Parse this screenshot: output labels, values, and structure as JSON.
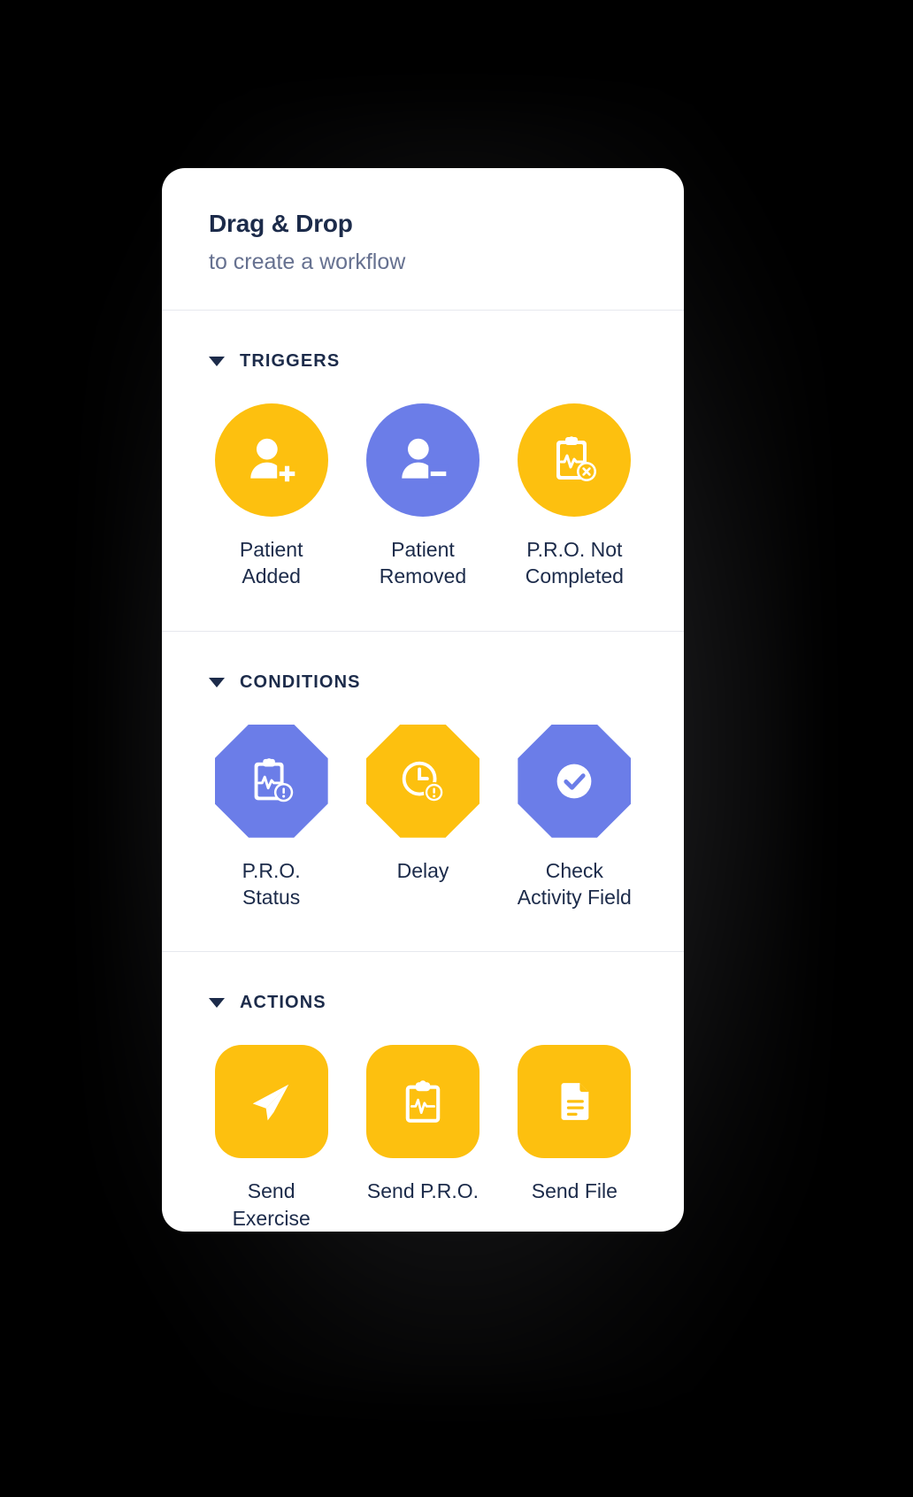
{
  "header": {
    "title": "Drag & Drop",
    "subtitle": "to create a workflow"
  },
  "colors": {
    "yellow": "#FDC00F",
    "blue": "#6B7DE8",
    "navy": "#1C2B4A",
    "subtitle_gray": "#667190",
    "card_bg": "#FFFFFF",
    "page_bg": "#000000",
    "divider": "#E6E8EE"
  },
  "sections": [
    {
      "id": "triggers",
      "title": "TRIGGERS",
      "caret_icon": "chevron-down-icon",
      "shape": "circle",
      "items": [
        {
          "label": "Patient\nAdded",
          "label_line1": "Patient",
          "label_line2": "Added",
          "icon": "person-add-icon",
          "color": "#FDC00F"
        },
        {
          "label": "Patient\nRemoved",
          "label_line1": "Patient",
          "label_line2": "Removed",
          "icon": "person-remove-icon",
          "color": "#6B7DE8"
        },
        {
          "label": "P.R.O. Not\nCompleted",
          "label_line1": "P.R.O. Not",
          "label_line2": "Completed",
          "icon": "clipboard-pulse-x-icon",
          "color": "#FDC00F"
        }
      ]
    },
    {
      "id": "conditions",
      "title": "CONDITIONS",
      "caret_icon": "chevron-down-icon",
      "shape": "octagon",
      "items": [
        {
          "label": "P.R.O.\nStatus",
          "label_line1": "P.R.O.",
          "label_line2": "Status",
          "icon": "clipboard-pulse-alert-icon",
          "color": "#6B7DE8"
        },
        {
          "label": "Delay",
          "label_line1": "Delay",
          "label_line2": "",
          "icon": "clock-alert-icon",
          "color": "#FDC00F"
        },
        {
          "label": "Check\nActivity Field",
          "label_line1": "Check",
          "label_line2": "Activity Field",
          "icon": "check-circle-icon",
          "color": "#6B7DE8"
        }
      ]
    },
    {
      "id": "actions",
      "title": "ACTIONS",
      "caret_icon": "chevron-down-icon",
      "shape": "rounded",
      "items": [
        {
          "label": "Send\nExercise",
          "label_line1": "Send",
          "label_line2": "Exercise",
          "icon": "paper-plane-icon",
          "color": "#FDC00F"
        },
        {
          "label": "Send P.R.O.",
          "label_line1": "Send P.R.O.",
          "label_line2": "",
          "icon": "clipboard-pulse-icon",
          "color": "#FDC00F"
        },
        {
          "label": "Send File",
          "label_line1": "Send File",
          "label_line2": "",
          "icon": "document-icon",
          "color": "#FDC00F"
        }
      ]
    }
  ]
}
